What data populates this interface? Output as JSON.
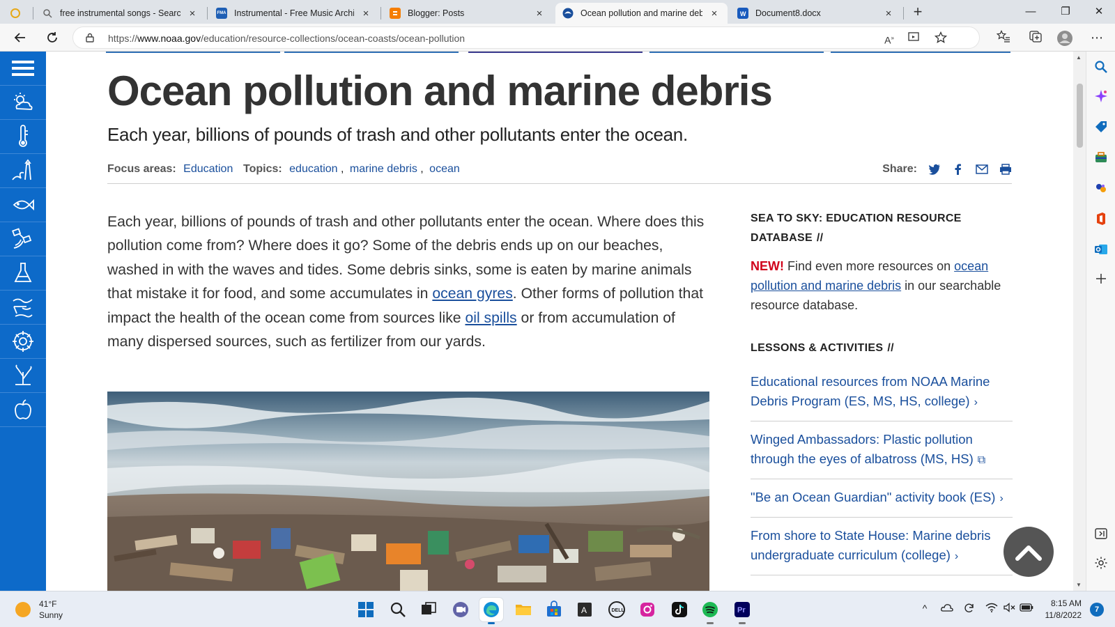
{
  "tabs": [
    {
      "title": "free instrumental songs - Search",
      "favicon": "search-icon",
      "active": false
    },
    {
      "title": "Instrumental - Free Music Archive",
      "favicon": "fma-icon",
      "favicon_text": "FMA",
      "active": false
    },
    {
      "title": "Blogger: Posts",
      "favicon": "blogger-icon",
      "active": false
    },
    {
      "title": "Ocean pollution and marine debris",
      "favicon": "noaa-icon",
      "active": true
    },
    {
      "title": "Document8.docx",
      "favicon": "word-icon",
      "active": false
    }
  ],
  "address": {
    "url_prefix": "https://",
    "url_host": "www.noaa.gov",
    "url_path": "/education/resource-collections/ocean-coasts/ocean-pollution"
  },
  "article": {
    "title": "Ocean pollution and marine debris",
    "subtitle": "Each year, billions of pounds of trash and other pollutants enter the ocean.",
    "focus_label": "Focus areas:",
    "focus_value": "Education",
    "topics_label": "Topics:",
    "topics": [
      "education",
      "marine debris",
      "ocean"
    ],
    "share_label": "Share:",
    "intro": {
      "p1": "Each year, billions of pounds of trash and other pollutants enter the ocean. Where does this pollution come from? Where does it go? Some of the debris ends up on our beaches, washed in with the waves and tides. Some debris sinks, some is eaten by marine animals that mistake it for food, and some accumulates in ",
      "link1": "ocean gyres",
      "p2": ". Other forms of pollution that impact the health of the ocean come from sources like ",
      "link2": "oil spills",
      "p3": " or from accumulation of many dispersed sources, such as fertilizer from our yards."
    }
  },
  "sidebar": {
    "db_heading": "SEA TO SKY: EDUCATION RESOURCE DATABASE",
    "heading_slash": "//",
    "db_new": "NEW!",
    "db_text_1": " Find even more resources on ",
    "db_link": "ocean pollution and marine debris",
    "db_text_2": " in our searchable resource database.",
    "lessons_heading": "LESSONS & ACTIVITIES",
    "lessons": [
      {
        "label": "Educational resources from NOAA Marine Debris Program (ES, MS, HS, college)",
        "glyph": "›"
      },
      {
        "label": "Winged Ambassadors: Plastic pollution through the eyes of albatross (MS, HS)",
        "glyph": "⧉"
      },
      {
        "label": "\"Be an Ocean Guardian\" activity book (ES)",
        "glyph": "›"
      },
      {
        "label": "From shore to State House: Marine debris undergraduate curriculum (college)",
        "glyph": "›"
      }
    ]
  },
  "rail_icons": [
    "menu-icon",
    "weather-icon",
    "climate-icon",
    "coasts-icon",
    "fish-icon",
    "satellite-icon",
    "science-icon",
    "data-icon",
    "navigation-icon",
    "ecosystem-icon",
    "education-icon"
  ],
  "taskbar": {
    "weather_temp": "41°F",
    "weather_cond": "Sunny",
    "time": "8:15 AM",
    "date": "11/8/2022",
    "notifications": "7",
    "app_a_letter": "A",
    "app_pr_letter": "Pr",
    "dell_text": "DELL"
  },
  "colors": {
    "rail_blue": "#0d6ac9",
    "link_blue": "#1a4f9c",
    "new_red": "#d0021b"
  }
}
